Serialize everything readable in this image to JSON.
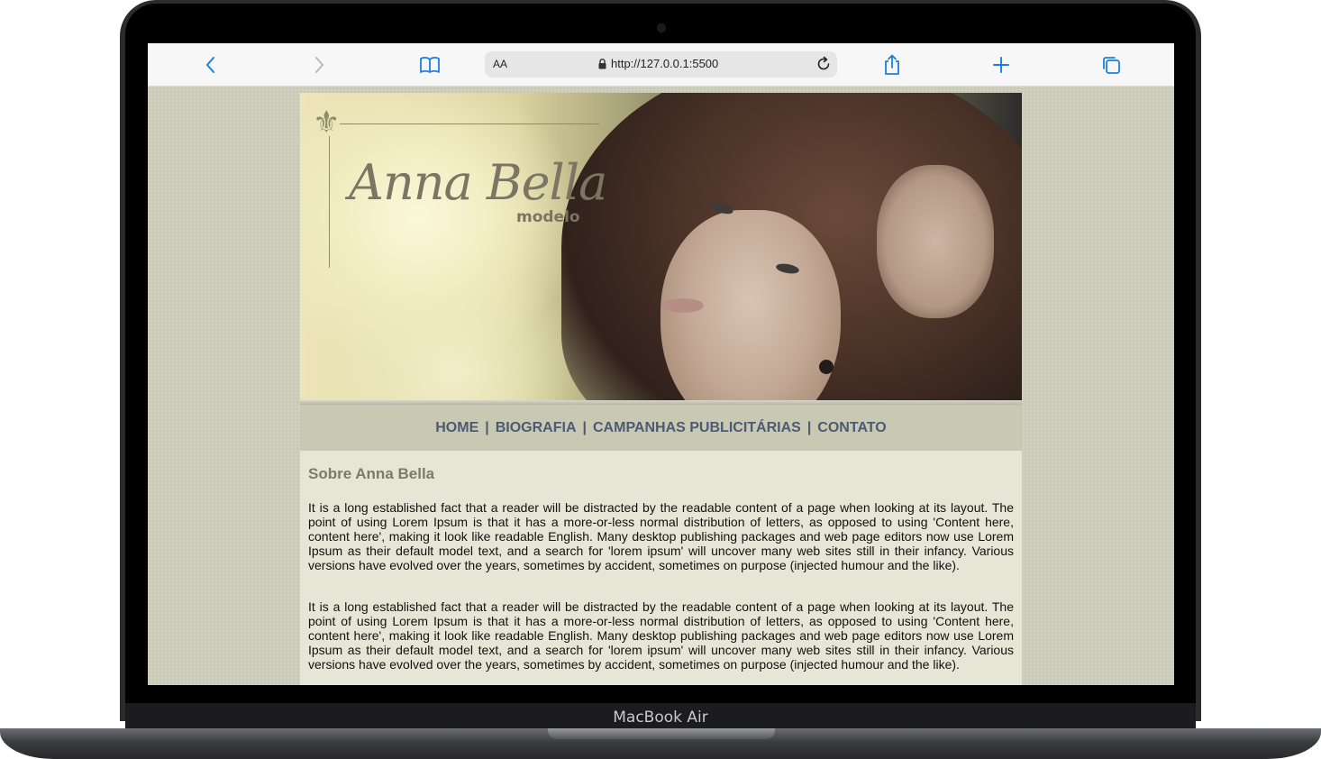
{
  "device": {
    "label": "MacBook Air"
  },
  "browser": {
    "text_size_label": "AA",
    "url": "http://127.0.0.1:5500"
  },
  "site": {
    "logo_title": "Anna Bella",
    "logo_subtitle": "modelo",
    "nav": [
      {
        "label": "HOME"
      },
      {
        "label": "BIOGRAFIA"
      },
      {
        "label": "CAMPANHAS PUBLICITÁRIAS"
      },
      {
        "label": "CONTATO"
      }
    ],
    "nav_separator": "|",
    "section_title": "Sobre Anna Bella",
    "paragraphs": [
      "It is a long established fact that a reader will be distracted by the readable content of a page when looking at its layout. The point of using Lorem Ipsum is that it has a more-or-less normal distribution of letters, as opposed to using 'Content here, content here', making it look like readable English. Many desktop publishing packages and web page editors now use Lorem Ipsum as their default model text, and a search for 'lorem ipsum' will uncover many web sites still in their infancy. Various versions have evolved over the years, sometimes by accident, sometimes on purpose (injected humour and the like).",
      "It is a long established fact that a reader will be distracted by the readable content of a page when looking at its layout. The point of using Lorem Ipsum is that it has a more-or-less normal distribution of letters, as opposed to using 'Content here, content here', making it look like readable English. Many desktop publishing packages and web page editors now use Lorem Ipsum as their default model text, and a search for 'lorem ipsum' will uncover many web sites still in their infancy. Various versions have evolved over the years, sometimes by accident, sometimes on purpose (injected humour and the like)."
    ]
  },
  "colors": {
    "page_background": "#cfcfbd",
    "nav_background": "#c8c8b3",
    "nav_link": "#4d5a73",
    "content_background": "#e6e6d6",
    "section_title": "#7b7b6c",
    "toolbar_icon": "#1a7fe0"
  },
  "icons": {
    "back": "chevron-left-icon",
    "forward": "chevron-right-icon",
    "bookmarks": "book-icon",
    "lock": "lock-icon",
    "reload": "reload-icon",
    "share": "share-icon",
    "new_tab": "plus-icon",
    "tabs": "tabs-icon",
    "ornament": "fleur-de-lis-icon"
  }
}
